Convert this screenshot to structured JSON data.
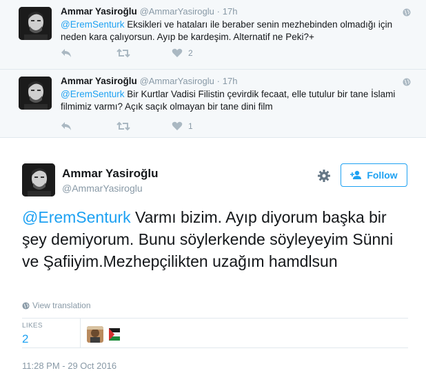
{
  "replies": [
    {
      "name": "Ammar Yasiroğlu",
      "handle": "@AmmarYasiroglu",
      "dot": "·",
      "time": "17h",
      "mention": "@EremSenturk",
      "text": " Eksikleri ve hataları ile beraber senin mezhebinden olmadığı için neden kara çalıyorsun. Ayıp be kardeşim. Alternatif ne Peki?+",
      "retweets": "",
      "likes": "2"
    },
    {
      "name": "Ammar Yasiroğlu",
      "handle": "@AmmarYasiroglu",
      "dot": "·",
      "time": "17h",
      "mention": "@EremSenturk",
      "text": " Bir Kurtlar Vadisi Filistin çevirdik fecaat, elle tutulur bir tane İslami filmimiz varmı? Açık saçık olmayan bir tane dini film",
      "retweets": "",
      "likes": "1"
    }
  ],
  "main_tweet": {
    "name": "Ammar Yasiroğlu",
    "handle": "@AmmarYasiroglu",
    "follow_label": "Follow",
    "mention": "@EremSenturk",
    "text": " Varmı bizim. Ayıp diyorum başka bir şey demiyorum. Bunu söylerkende söyleyeyim Sünni ve Şafiiyim.Mezhepçilikten uzağım hamdlsun",
    "view_translation": "View translation",
    "likes_label": "LIKES",
    "likes_count": "2",
    "timestamp": "11:28 PM - 29 Oct 2016"
  },
  "colors": {
    "accent": "#1da1f2",
    "muted": "#8899a6",
    "action_icon": "#aab8c2",
    "reply_bg": "#f5f8fa"
  },
  "icons": [
    "globe-icon",
    "reply-icon",
    "retweet-icon",
    "like-icon",
    "gear-icon",
    "follow-user-icon"
  ]
}
